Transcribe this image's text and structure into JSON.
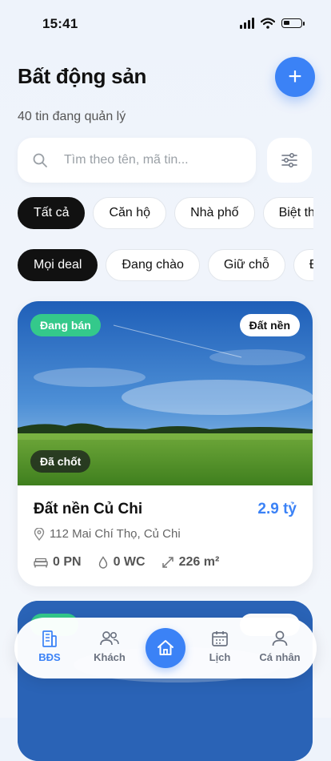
{
  "status_bar": {
    "time": "15:41"
  },
  "header": {
    "title": "Bất động sản",
    "add_label": "+"
  },
  "subtitle": "40 tin đang quản lý",
  "search": {
    "placeholder": "Tìm theo tên, mã tin..."
  },
  "type_filters": [
    {
      "label": "Tất cả",
      "active": true
    },
    {
      "label": "Căn hộ",
      "active": false
    },
    {
      "label": "Nhà phố",
      "active": false
    },
    {
      "label": "Biệt thự",
      "active": false
    }
  ],
  "deal_filters": [
    {
      "label": "Mọi deal",
      "active": true
    },
    {
      "label": "Đang chào",
      "active": false
    },
    {
      "label": "Giữ chỗ",
      "active": false
    },
    {
      "label": "Đã chốt",
      "active": false
    }
  ],
  "listing": {
    "status_badge": "Đang bán",
    "type_badge": "Đất nền",
    "deal_badge": "Đã chốt",
    "name": "Đất nền Củ Chi",
    "price": "2.9 tỷ",
    "address": "112 Mai Chí Thọ, Củ Chi",
    "bedrooms": "0 PN",
    "bathrooms": "0 WC",
    "area": "226 m²"
  },
  "bottom_nav": {
    "items": [
      {
        "label": "BĐS",
        "icon": "building-icon",
        "active": true
      },
      {
        "label": "Khách",
        "icon": "users-icon",
        "active": false
      },
      {
        "label": "Lịch",
        "icon": "calendar-icon",
        "active": false
      },
      {
        "label": "Cá nhân",
        "icon": "user-icon",
        "active": false
      }
    ],
    "home_icon": "home-icon"
  },
  "colors": {
    "accent": "#3b82f6",
    "selling_badge": "#34c98b",
    "dark": "#111111"
  }
}
